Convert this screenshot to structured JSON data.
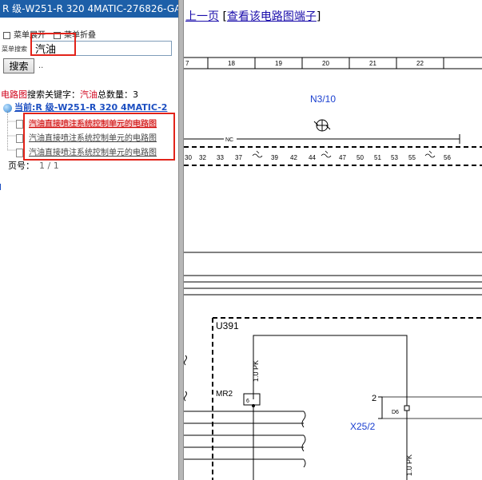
{
  "left_panel": {
    "window_title": "R 级-W251-R 320 4MATIC-276826-GA",
    "menu": {
      "expand_label": "菜单展开",
      "collapse_label": "菜单折叠"
    },
    "search": {
      "label": "菜单搜索",
      "value": "汽油",
      "button_label": "搜索",
      "dots": ".."
    },
    "results": {
      "prefix": "电路图",
      "keyword_label": "搜索关键字：",
      "keyword": "汽油",
      "total_label": "总数量：",
      "total": "3"
    },
    "tree": {
      "root_label": "当前:R 级-W251-R 320 4MATIC-2",
      "items": [
        {
          "label": "汽油直接喷注系统控制单元的电路图",
          "selected": true
        },
        {
          "label": "汽油直接喷注系统控制单元的电路图",
          "selected": false
        },
        {
          "label": "汽油直接喷注系统控制单元的电路图",
          "selected": false
        }
      ]
    },
    "pagination": {
      "label": "页号：",
      "value": "1 / 1"
    }
  },
  "right_panel": {
    "nav": {
      "prev_label": "上一页",
      "view_terminal_label": "查看该电路图端子"
    },
    "diagram": {
      "grid_numbers": [
        "7",
        "18",
        "19",
        "20",
        "21",
        "22"
      ],
      "component_n": "N3/10",
      "nc_label": "NC",
      "pins": [
        "30",
        "32",
        "33",
        "37",
        "39",
        "42",
        "44",
        "47",
        "50",
        "51",
        "53",
        "55",
        "56"
      ],
      "component_u": "U391",
      "wire_labels": [
        "1.0 PK",
        "1.0 PK"
      ],
      "connector_mr": "MR2",
      "mr_pin": "6",
      "pin_d6": "D6",
      "pin_2": "2",
      "component_x": "X25/2"
    }
  },
  "colors": {
    "title_bar": "#1d5fa8",
    "highlight": "#e2231a",
    "link": "#1a0dab",
    "component_label": "#1a3fd0"
  }
}
